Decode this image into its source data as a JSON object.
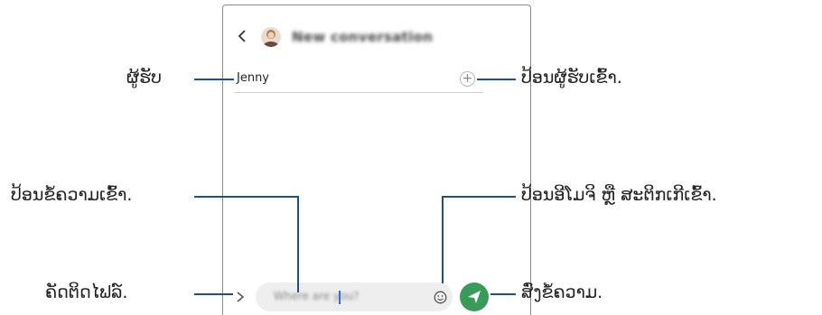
{
  "header": {
    "title": "New conversation"
  },
  "recipient": {
    "value": "Jenny"
  },
  "composer": {
    "placeholder": "Where are you?"
  },
  "callouts": {
    "recipient": "ຜູ້ຮັບ",
    "add_recipient": "ປ້ອນຜູ້ຮັບເຂົ້າ.",
    "enter_message": "ປ້ອນຂໍ້ຄວາມເຂົ້າ.",
    "emoji_sticker": "ປ້ອນອີໂມຈິ ຫຼື ສະຕິກເກີເຂົ້າ.",
    "attach_file": "ຄັດຕິດໄຟລ໌.",
    "send": "ສົ່ງຂໍ້ຄວາມ."
  },
  "colors": {
    "accent_line": "#1a4fa0",
    "send_button": "#3a9a5a",
    "cursor": "#2b6fd6"
  },
  "icons": [
    "back-arrow-icon",
    "contact-avatar",
    "plus-icon",
    "chevron-right-icon",
    "smiley-icon",
    "send-arrow-icon"
  ]
}
